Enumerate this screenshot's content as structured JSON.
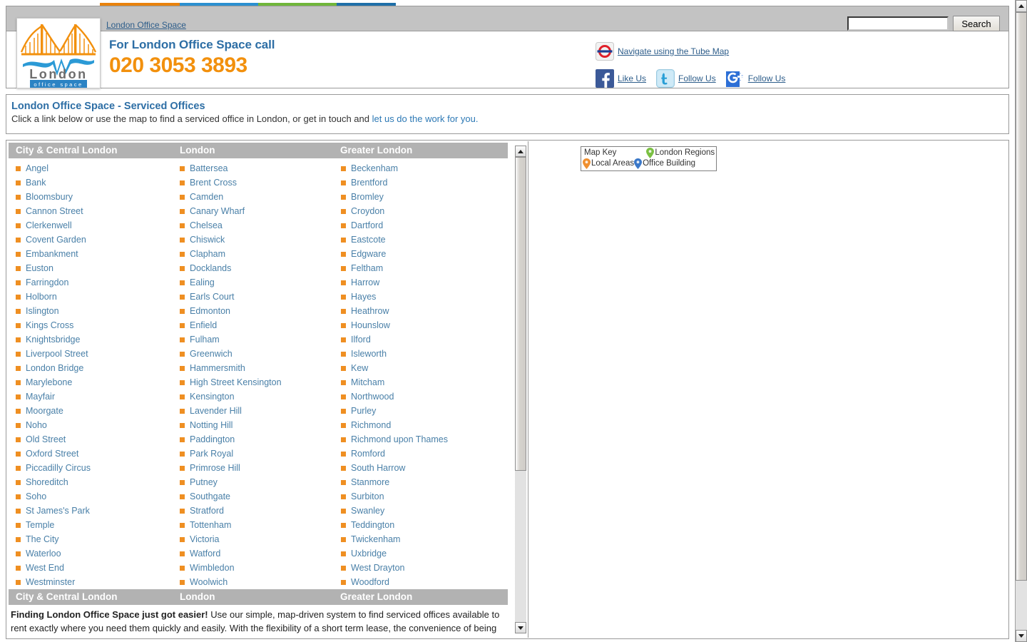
{
  "header": {
    "brand_link": "London Office Space",
    "phone_label": "For London Office Space call",
    "phone_number": "020 3053 3893",
    "logo": {
      "word": "London",
      "tagline": "office  space"
    },
    "search": {
      "value": "",
      "placeholder": "",
      "button_label": "Search"
    },
    "links": [
      {
        "icon": "tube-roundel-icon",
        "label": "Navigate using the Tube Map"
      },
      {
        "icon": "facebook-icon",
        "label": "Like Us"
      },
      {
        "icon": "twitter-icon",
        "label": "Follow Us"
      },
      {
        "icon": "google-plus-icon",
        "label": "Follow Us"
      }
    ],
    "strip_colors": [
      "#e8820c",
      "#2b8fd0",
      "#70b63a",
      "#1f6fa8"
    ]
  },
  "title_panel": {
    "title": "London Office Space - Serviced Offices",
    "subtitle_before": "Click a link below or use the map to find a serviced office in London, or get in touch and ",
    "subtitle_link": "let us do the work for you.",
    "link_color": "#2d79b5"
  },
  "locations": {
    "headers": [
      "City & Central London",
      "London",
      "Greater London"
    ],
    "footers": [
      "City & Central London",
      "London",
      "Greater London"
    ],
    "bullet_color": "#ef8f22",
    "link_color": "#4a80a8",
    "columns": [
      {
        "name": "City & Central London",
        "items": [
          "Angel",
          "Bank",
          "Bloomsbury",
          "Cannon Street",
          "Clerkenwell",
          "Covent Garden",
          "Embankment",
          "Euston",
          "Farringdon",
          "Holborn",
          "Islington",
          "Kings Cross",
          "Knightsbridge",
          "Liverpool Street",
          "London Bridge",
          "Marylebone",
          "Mayfair",
          "Moorgate",
          "Noho",
          "Old Street",
          "Oxford Street",
          "Piccadilly Circus",
          "Shoreditch",
          "Soho",
          "St James's Park",
          "Temple",
          "The City",
          "Waterloo",
          "West End",
          "Westminster"
        ]
      },
      {
        "name": "London",
        "items": [
          "Battersea",
          "Brent Cross",
          "Camden",
          "Canary Wharf",
          "Chelsea",
          "Chiswick",
          "Clapham",
          "Docklands",
          "Ealing",
          "Earls Court",
          "Edmonton",
          "Enfield",
          "Fulham",
          "Greenwich",
          "Hammersmith",
          "High Street Kensington",
          "Kensington",
          "Lavender Hill",
          "Notting Hill",
          "Paddington",
          "Park Royal",
          "Primrose Hill",
          "Putney",
          "Southgate",
          "Stratford",
          "Tottenham",
          "Victoria",
          "Watford",
          "Wimbledon",
          "Woolwich"
        ]
      },
      {
        "name": "Greater London",
        "items": [
          "Beckenham",
          "Brentford",
          "Bromley",
          "Croydon",
          "Dartford",
          "Eastcote",
          "Edgware",
          "Feltham",
          "Harrow",
          "Hayes",
          "Heathrow",
          "Hounslow",
          "Ilford",
          "Isleworth",
          "Kew",
          "Mitcham",
          "Northwood",
          "Purley",
          "Richmond",
          "Richmond upon Thames",
          "Romford",
          "South Harrow",
          "Stanmore",
          "Surbiton",
          "Swanley",
          "Teddington",
          "Twickenham",
          "Uxbridge",
          "West Drayton",
          "Woodford"
        ]
      }
    ]
  },
  "bottom_text": {
    "lead": "Finding London Office Space just got easier!",
    "rest": " Use our simple, map-driven system to find serviced offices available to",
    "line2": "rent exactly where you need them quickly and easily. With the flexibility of a short term lease, the convenience of being"
  },
  "map_key": {
    "title": "Map Key",
    "entries": [
      {
        "label": "London Regions",
        "pin_color": "#7bc043"
      },
      {
        "label": "Local Areas",
        "pin_color": "#f09030"
      },
      {
        "label": "Office Building",
        "pin_color": "#3b78c8"
      }
    ]
  }
}
